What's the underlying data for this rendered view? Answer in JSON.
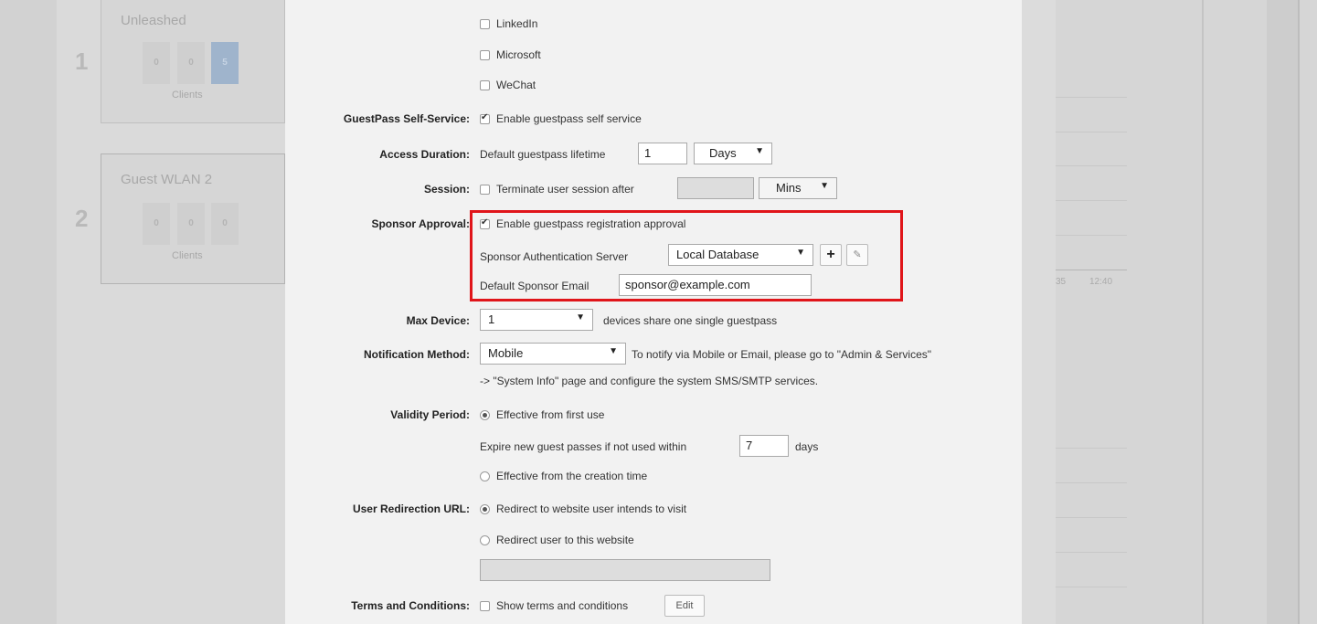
{
  "background": {
    "wlans": [
      {
        "number": "1",
        "title": "Unleashed",
        "counts": [
          "0",
          "0",
          "5"
        ],
        "clients_label": "Clients"
      },
      {
        "number": "2",
        "title": "Guest WLAN 2",
        "counts": [
          "0",
          "0",
          "0"
        ],
        "clients_label": "Clients"
      }
    ],
    "chart_ticks": [
      "35",
      "12:40"
    ]
  },
  "social": {
    "linkedin": "LinkedIn",
    "microsoft": "Microsoft",
    "wechat": "WeChat"
  },
  "guestpass_self_service": {
    "label": "GuestPass Self-Service:",
    "checkbox": "Enable guestpass self service"
  },
  "access_duration": {
    "label": "Access Duration:",
    "text": "Default guestpass lifetime",
    "value": "1",
    "unit": "Days"
  },
  "session": {
    "label": "Session:",
    "checkbox": "Terminate user session after",
    "value": "",
    "unit": "Mins"
  },
  "sponsor_approval": {
    "label": "Sponsor Approval:",
    "checkbox": "Enable guestpass registration approval",
    "auth_server_label": "Sponsor Authentication Server",
    "auth_server_value": "Local Database",
    "add_label": "+",
    "edit_label": "✎",
    "email_label": "Default Sponsor Email",
    "email_value": "sponsor@example.com"
  },
  "max_device": {
    "label": "Max Device:",
    "value": "1",
    "text": "devices share one single guestpass"
  },
  "notification": {
    "label": "Notification Method:",
    "value": "Mobile",
    "text1": "To notify via Mobile or Email, please go to \"Admin & Services\"",
    "text2": "-> \"System Info\" page and configure the system SMS/SMTP services."
  },
  "validity": {
    "label": "Validity Period:",
    "option1": "Effective from first use",
    "expire_text": "Expire new guest passes if not used within",
    "expire_value": "7",
    "expire_unit": "days",
    "option2": "Effective from the creation time"
  },
  "redirection": {
    "label": "User Redirection URL:",
    "option1": "Redirect to website user intends to visit",
    "option2": "Redirect user to this website",
    "url_value": ""
  },
  "terms": {
    "label": "Terms and Conditions:",
    "checkbox": "Show terms and conditions",
    "edit_button": "Edit"
  }
}
